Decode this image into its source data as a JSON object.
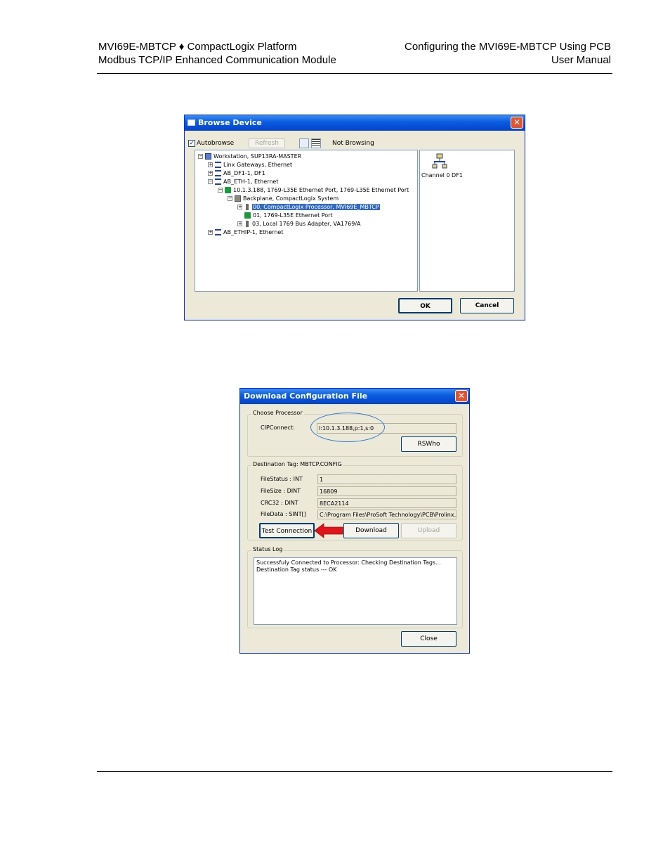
{
  "header": {
    "left_line1": "MVI69E-MBTCP ♦ CompactLogix Platform",
    "left_line2": "Modbus TCP/IP Enhanced Communication Module",
    "right_line1": "Configuring the MVI69E-MBTCP Using PCB",
    "right_line2": "User Manual"
  },
  "browse_dialog": {
    "title": "Browse Device",
    "autobrowse_label": "Autobrowse",
    "autobrowse_checked": true,
    "refresh_label": "Refresh",
    "status": "Not Browsing",
    "tree": [
      {
        "label": "Workstation, SUP13RA-MASTER",
        "icon": "computer-icon",
        "expander": "−"
      },
      {
        "label": "Linx Gateways, Ethernet",
        "icon": "network-icon",
        "expander": "+"
      },
      {
        "label": "AB_DF1-1, DF1",
        "icon": "network-icon",
        "expander": "+"
      },
      {
        "label": "AB_ETH-1, Ethernet",
        "icon": "network-icon",
        "expander": "−"
      },
      {
        "label": "10.1.3.188, 1769-L35E Ethernet Port, 1769-L35E Ethernet Port",
        "icon": "port-icon",
        "expander": "−"
      },
      {
        "label": "Backplane, CompactLogix System",
        "icon": "backplane-icon",
        "expander": "−"
      },
      {
        "label": "00, CompactLogix Processor, MVI69E_MBTCP",
        "icon": "module-icon",
        "expander": "+",
        "selected": true
      },
      {
        "label": "01, 1769-L35E Ethernet Port",
        "icon": "port-icon",
        "expander": ""
      },
      {
        "label": "03, Local 1769 Bus Adapter, VA1769/A",
        "icon": "module-icon",
        "expander": "+"
      },
      {
        "label": "AB_ETHIP-1, Ethernet",
        "icon": "network-icon",
        "expander": "+"
      }
    ],
    "right_pane_item": "Channel 0 DF1",
    "ok_label": "OK",
    "cancel_label": "Cancel"
  },
  "download_dialog": {
    "title": "Download Configuration File",
    "choose_processor_label": "Choose Processor",
    "cipconnect_label": "CIPConnect:",
    "cipconnect_value": "l:10.1.3.188,p:1,s:0",
    "rswho_label": "RSWho",
    "dest_tag_label": "Destination Tag: MBTCP.CONFIG",
    "fields": [
      {
        "label": "FileStatus : INT",
        "value": "1"
      },
      {
        "label": "FileSize   : DINT",
        "value": "16809"
      },
      {
        "label": "CRC32      : DINT",
        "value": "8ECA2114"
      },
      {
        "label": "FileData   : SINT[]",
        "value": "C:\\Program Files\\ProSoft Technology\\PCB\\Prolinx.c"
      }
    ],
    "test_connection_label": "Test Connection",
    "download_label": "Download",
    "upload_label": "Upload",
    "status_log_label": "Status Log",
    "status_log_lines": [
      "Successfuly Connected to Processor: Checking Destination Tags...",
      "Destination Tag status --- OK"
    ],
    "close_label": "Close",
    "arrow_color": "#e0141b",
    "highlight_color": "#2b7bd6"
  }
}
